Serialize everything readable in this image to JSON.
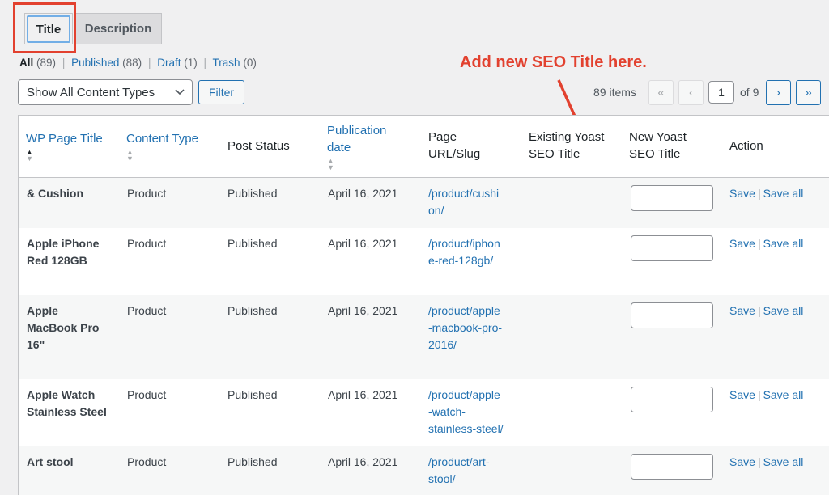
{
  "tabs": [
    {
      "label": "Title",
      "active": true
    },
    {
      "label": "Description",
      "active": false
    }
  ],
  "views": {
    "all": {
      "label": "All",
      "count": "(89)"
    },
    "published": {
      "label": "Published",
      "count": "(88)"
    },
    "draft": {
      "label": "Draft",
      "count": "(1)"
    },
    "trash": {
      "label": "Trash",
      "count": "(0)"
    },
    "separator": "|"
  },
  "annotation": {
    "text": "Add new SEO Title here.",
    "color": "#e2412f"
  },
  "toolbar": {
    "content_type_select": "Show All Content Types",
    "filter_label": "Filter",
    "items_count": "89 items",
    "first_page": "«",
    "prev_page": "‹",
    "current_page": "1",
    "of_pages": "of 9",
    "next_page": "›",
    "last_page": "»"
  },
  "table": {
    "columns": {
      "wp_page_title": "WP Page Title",
      "content_type": "Content Type",
      "post_status": "Post Status",
      "publication_date_1": "Publication",
      "publication_date_2": "date",
      "page_url_1": "Page",
      "page_url_2": "URL/Slug",
      "existing_1": "Existing Yoast",
      "existing_2": "SEO Title",
      "new_1": "New Yoast",
      "new_2": "SEO Title",
      "action": "Action"
    },
    "rows": [
      {
        "title_lines": [
          "& Cushion"
        ],
        "type": "Product",
        "status": "Published",
        "date": "April 16, 2021",
        "slug_lines": [
          "/product/cushi",
          "on/"
        ],
        "new_title": "",
        "save": "Save",
        "save_all": "Save all"
      },
      {
        "title_lines": [
          "Apple iPhone",
          "Red 128GB"
        ],
        "type": "Product",
        "status": "Published",
        "date": "April 16, 2021",
        "slug_lines": [
          "/product/iphon",
          "e-red-128gb/"
        ],
        "new_title": "",
        "save": "Save",
        "save_all": "Save all"
      },
      {
        "title_lines": [
          "Apple",
          "MacBook Pro",
          "16\""
        ],
        "type": "Product",
        "status": "Published",
        "date": "April 16, 2021",
        "slug_lines": [
          "/product/apple",
          "-macbook-pro-",
          "2016/"
        ],
        "new_title": "",
        "save": "Save",
        "save_all": "Save all"
      },
      {
        "title_lines": [
          "Apple Watch",
          "Stainless Steel"
        ],
        "type": "Product",
        "status": "Published",
        "date": "April 16, 2021",
        "slug_lines": [
          "/product/apple",
          "-watch-",
          "stainless-steel/"
        ],
        "new_title": "",
        "save": "Save",
        "save_all": "Save all"
      },
      {
        "title_lines": [
          "Art stool"
        ],
        "type": "Product",
        "status": "Published",
        "date": "April 16, 2021",
        "slug_lines": [
          "/product/art-",
          "stool/"
        ],
        "new_title": "",
        "save": "Save",
        "save_all": "Save all"
      }
    ]
  },
  "colors": {
    "accent": "#2271b1",
    "highlight": "#e2412f"
  }
}
